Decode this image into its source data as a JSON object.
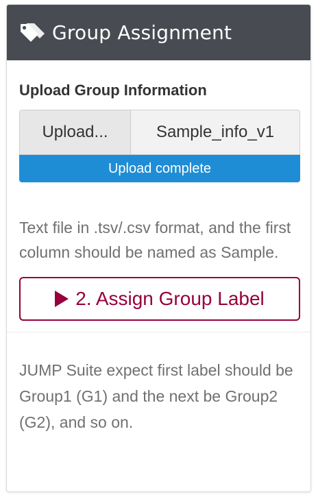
{
  "panel": {
    "title": "Group Assignment",
    "icon": "tags-icon"
  },
  "upload": {
    "heading": "Upload Group Information",
    "browse_label": "Upload...",
    "file_name": "Sample_info_v1",
    "progress_label": "Upload complete",
    "progress_fraction": 1.0
  },
  "help_text": "Text file in .tsv/.csv format, and the first column should be named as Sample.",
  "assign_button": {
    "label": "2. Assign Group Label",
    "icon": "play-icon"
  },
  "note_text": "JUMP Suite expect first label should be Group1 (G1) and the next be Group2 (G2), and so on.",
  "colors": {
    "header_bg": "#484c52",
    "progress": "#1f8dd6",
    "accent": "#96003c"
  }
}
